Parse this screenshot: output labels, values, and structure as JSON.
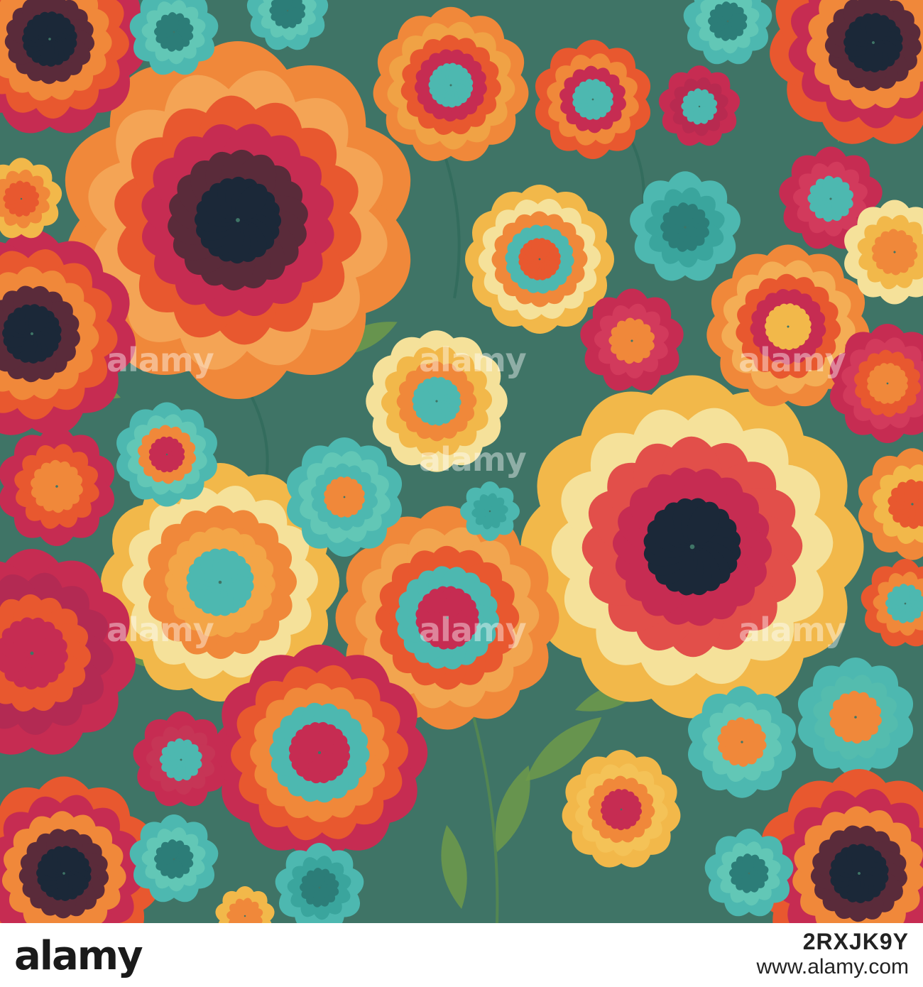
{
  "artwork": {
    "background": "#3f7466",
    "palette": [
      "#f0883a",
      "#f5e19a",
      "#c62c52",
      "#4db8b0",
      "#e8582f",
      "#f2b84a",
      "#1b2838",
      "#6e9a4a"
    ]
  },
  "watermark": {
    "text": "alamy"
  },
  "footer": {
    "logo": "alamy",
    "image_id": "2RXJK9Y",
    "url": "www.alamy.com"
  }
}
